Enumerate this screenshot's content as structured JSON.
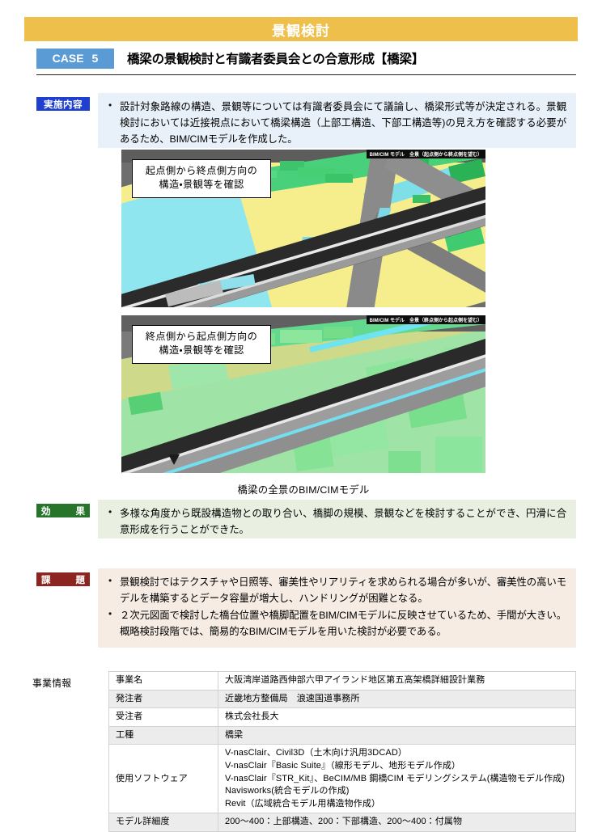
{
  "banner": {
    "title": "景観検討"
  },
  "case": {
    "badge_label": "CASE",
    "badge_number": "5",
    "title": "橋梁の景観検討と有識者委員会との合意形成【橋梁】"
  },
  "sections": {
    "implementation": {
      "label": "実施内容",
      "label_color": "#1f3fd0",
      "box_color": "#e8f0f9",
      "bullets": [
        "設計対象路線の構造、景観等については有識者委員会にて議論し、橋梁形式等が決定される。景観検討においては近接視点において橋梁構造（上部工構造、下部工構造等)の見え方を確認する必要があるため、BIM/CIMモデルを作成した。"
      ]
    },
    "effect": {
      "label_left": "効",
      "label_right": "果",
      "label_color": "#27752b",
      "box_color": "#e9f0e1",
      "bullets": [
        "多様な角度から既設構造物との取り合い、橋脚の規模、景観などを検討することができ、円滑に合意形成を行うことができた。"
      ]
    },
    "issues": {
      "label_left": "課",
      "label_right": "題",
      "label_color": "#8c2420",
      "box_color": "#f6ece4",
      "bullets": [
        "景観検討ではテクスチャや日照等、審美性やリアリティを求められる場合が多いが、審美性の高いモデルを構築するとデータ容量が増大し、ハンドリングが困難となる。",
        "２次元図面で検討した橋台位置や橋脚配置をBIM/CIMモデルに反映させているため、手間が大きい。概略検討段階では、簡易的なBIM/CIMモデルを用いた検討が必要である。"
      ]
    }
  },
  "figure": {
    "caption": "橋梁の全景のBIM/CIMモデル",
    "renders": [
      {
        "callout": "起点側から終点側方向の\n構造・景観等を確認",
        "tag": "BIM/CIM モデル　全景（起点側から終点側を望む）"
      },
      {
        "callout": "終点側から起点側方向の\n構造・景観等を確認",
        "tag": "BIM/CIM モデル　全景（終点側から起点側を望む）"
      }
    ]
  },
  "project_info": {
    "label": "事業情報",
    "rows": [
      {
        "key": "事業名",
        "value": "大阪湾岸道路西伸部六甲アイランド地区第五高架橋詳細設計業務"
      },
      {
        "key": "発注者",
        "value": "近畿地方整備局　浪速国道事務所"
      },
      {
        "key": "受注者",
        "value": "株式会社長大"
      },
      {
        "key": "工種",
        "value": "橋梁"
      },
      {
        "key": "使用ソフトウェア",
        "value": "V-nasClair、Civil3D（土木向け汎用3DCAD）\nV-nasClair『Basic Suite』（線形モデル、地形モデル作成）\nV-nasClair『STR_Kit』、BeCIM/MB 鋼橋CIM モデリングシステム(構造物モデル作成)\nNavisworks(統合モデルの作成)\nRevit（広域統合モデル用構造物作成）"
      },
      {
        "key": "モデル詳細度",
        "value": "200〜400：上部構造、200：下部構造、200〜400：付属物"
      }
    ]
  }
}
